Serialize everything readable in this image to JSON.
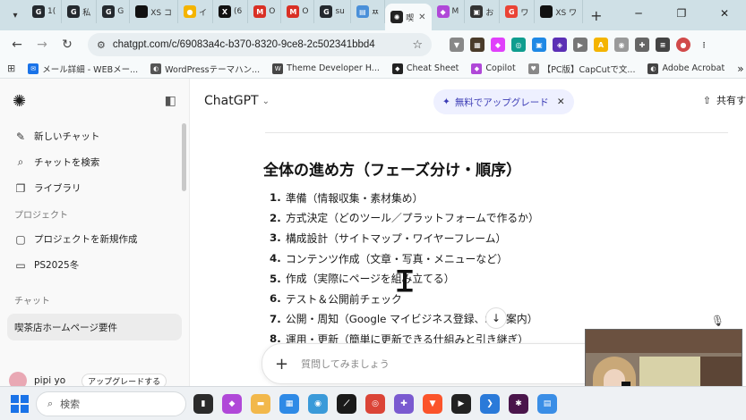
{
  "browser": {
    "tabs": [
      {
        "icon": "github-icon",
        "label": "1(",
        "color": "#24292e",
        "glyph": "G"
      },
      {
        "icon": "github-icon",
        "label": "私",
        "color": "#24292e",
        "glyph": "G"
      },
      {
        "icon": "github-icon",
        "label": "G",
        "color": "#24292e",
        "glyph": "G"
      },
      {
        "icon": "xs-icon",
        "label": "XS コ",
        "color": "#111111",
        "glyph": ""
      },
      {
        "icon": "chrome-icon",
        "label": "イ",
        "color": "#f4b400",
        "glyph": "●"
      },
      {
        "icon": "x-icon",
        "label": "(6",
        "color": "#111111",
        "glyph": "X"
      },
      {
        "icon": "gmail-icon",
        "label": "O",
        "color": "#d93025",
        "glyph": "M"
      },
      {
        "icon": "gmail-icon",
        "label": "O",
        "color": "#d93025",
        "glyph": "M"
      },
      {
        "icon": "github-icon",
        "label": "su",
        "color": "#24292e",
        "glyph": "G"
      },
      {
        "icon": "page-icon",
        "label": "ㅉ",
        "color": "#4a90d9",
        "glyph": "▤"
      },
      {
        "icon": "chatgpt-icon",
        "label": "喫",
        "color": "#222222",
        "glyph": "✺",
        "active": true
      },
      {
        "icon": "copilot-icon",
        "label": "M",
        "color": "#b048d8",
        "glyph": "◆"
      },
      {
        "icon": "bookmark-icon",
        "label": "お",
        "color": "#333333",
        "glyph": "▣"
      },
      {
        "icon": "google-icon",
        "label": "ワ",
        "color": "#ea4335",
        "glyph": "G"
      },
      {
        "icon": "xs-icon",
        "label": "XS ワ",
        "color": "#111111",
        "glyph": ""
      }
    ],
    "window_controls": [
      "─",
      "❐",
      "✕"
    ],
    "url": "chatgpt.com/c/69083a4c-b370-8320-9ce8-2c502341bbd4",
    "bookmarks": [
      {
        "label": "メール詳細 - WEBメー...",
        "color": "#1a73e8",
        "glyph": "✉"
      },
      {
        "label": "WordPressテーマハン...",
        "color": "#555555",
        "glyph": "◐"
      },
      {
        "label": "Theme Developer H...",
        "color": "#464646",
        "glyph": "W"
      },
      {
        "label": "Cheat Sheet",
        "color": "#222222",
        "glyph": "◆"
      },
      {
        "label": "Copilot",
        "color": "#b048d8",
        "glyph": "◆"
      },
      {
        "label": "【PC版】CapCutで文...",
        "color": "#888888",
        "glyph": "♥"
      },
      {
        "label": "Adobe Acrobat",
        "color": "#444444",
        "glyph": "◐"
      }
    ],
    "bookmarks_overflow": "»"
  },
  "sidebar": {
    "items": [
      {
        "icon": "edit-icon",
        "glyph": "✎",
        "label": "新しいチャット"
      },
      {
        "icon": "search-icon",
        "glyph": "⌕",
        "label": "チャットを検索"
      },
      {
        "icon": "library-icon",
        "glyph": "❐",
        "label": "ライブラリ"
      }
    ],
    "projects_heading": "プロジェクト",
    "projects": [
      {
        "icon": "new-folder-icon",
        "glyph": "▢",
        "label": "プロジェクトを新規作成"
      },
      {
        "icon": "folder-icon",
        "glyph": "▭",
        "label": "PS2025冬"
      }
    ],
    "chats_heading": "チャット",
    "chats": [
      "喫茶店ホームページ要件"
    ],
    "user_name": "pipi yo",
    "user_action": "アップグレードする"
  },
  "main": {
    "model_label": "ChatGPT",
    "upgrade_label": "無料でアップグレード",
    "share_label": "共有す",
    "heading": "全体の進め方（フェーズ分け・順序）",
    "steps": [
      {
        "num": "1.",
        "text": "準備（情報収集・素材集め）"
      },
      {
        "num": "2.",
        "text": "方式決定（どのツール／プラットフォームで作るか）"
      },
      {
        "num": "3.",
        "text": "構成設計（サイトマップ・ワイヤーフレーム）"
      },
      {
        "num": "4.",
        "text": "コンテンツ作成（文章・写真・メニューなど）"
      },
      {
        "num": "5.",
        "text": "作成（実際にページを組み立てる）"
      },
      {
        "num": "6.",
        "text": "テスト＆公開前チェック"
      },
      {
        "num": "7.",
        "text": "公開・周知（Google マイビジネス登録、SNS案内）"
      },
      {
        "num": "8.",
        "text": "運用・更新（簡単に更新できる仕組みと引き継ぎ）"
      }
    ],
    "composer_placeholder": "質問してみましょう"
  },
  "taskbar": {
    "search_placeholder": "検索",
    "apps": [
      {
        "name": "taskview-icon",
        "color": "#2b2b2b",
        "glyph": "▮"
      },
      {
        "name": "copilot-app-icon",
        "color": "#b048d8",
        "glyph": "◆"
      },
      {
        "name": "explorer-icon",
        "color": "#f2b84b",
        "glyph": "▬"
      },
      {
        "name": "photos-icon",
        "color": "#2e8ae6",
        "glyph": "▦"
      },
      {
        "name": "edge-icon",
        "color": "#3a9ad9",
        "glyph": "◉"
      },
      {
        "name": "chrome-app-icon",
        "color": "#1a1a1a",
        "glyph": "⟋"
      },
      {
        "name": "chrome-icon",
        "color": "#db4437",
        "glyph": "◎"
      },
      {
        "name": "puzzle-icon",
        "color": "#7a5ad0",
        "glyph": "✚"
      },
      {
        "name": "brave-icon",
        "color": "#fb542b",
        "glyph": "▼"
      },
      {
        "name": "media-icon",
        "color": "#222222",
        "glyph": "▶"
      },
      {
        "name": "vscode-icon",
        "color": "#2a7ad9",
        "glyph": "❯"
      },
      {
        "name": "slack-icon",
        "color": "#4a154b",
        "glyph": "✱"
      },
      {
        "name": "notepad-icon",
        "color": "#3a8ee6",
        "glyph": "▤"
      }
    ]
  }
}
